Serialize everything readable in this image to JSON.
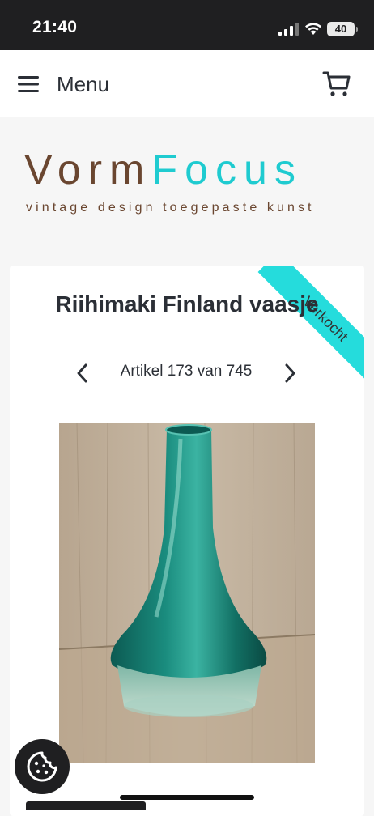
{
  "status_bar": {
    "time": "21:40",
    "battery": "40"
  },
  "header": {
    "menu_label": "Menu",
    "menu_icon": "hamburger-icon",
    "cart_icon": "shopping-cart-icon"
  },
  "logo": {
    "brand_part1": "Vorm",
    "brand_part2": "Focus",
    "tagline": "vintage design toegepaste kunst",
    "colors": {
      "brown": "#6a4630",
      "turquoise": "#1fcbd0"
    }
  },
  "product": {
    "title": "Riihimaki Finland vaasje",
    "ribbon": "Verkocht",
    "ribbon_color": "#25dcdc",
    "pager_text": "Artikel 173 van 745",
    "prev_icon": "chevron-left-icon",
    "next_icon": "chevron-right-icon",
    "image_alt": "green glass vase"
  },
  "cookie": {
    "icon": "cookie-icon"
  }
}
